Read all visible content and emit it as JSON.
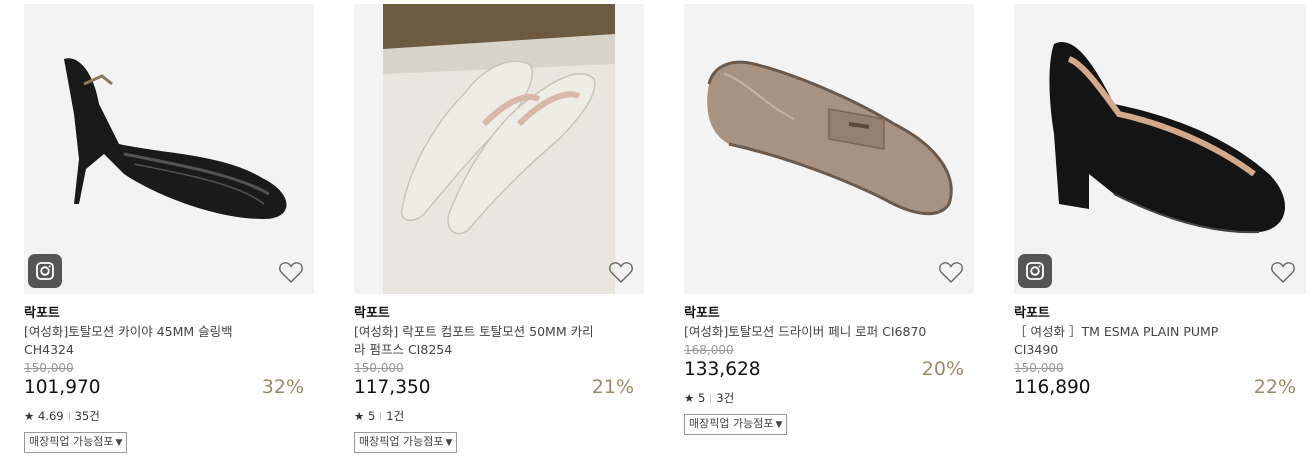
{
  "products": [
    {
      "brand": "락포트",
      "name": "[여성화]토탈모션 카이야 45MM 슬링백 CH4324",
      "original_price": "150,000",
      "price": "101,970",
      "discount": "32%",
      "rating": "4.69",
      "review_count": "35건",
      "pickup_label": "매장픽업 가능점포",
      "has_instagram": true,
      "image_icon": "black-patent-slingback-shoe-icon"
    },
    {
      "brand": "락포트",
      "name": "[여성화] 락포트 컴포트 토탈모션 50MM 카리라 펌프스 CI8254",
      "original_price": "150,000",
      "price": "117,350",
      "discount": "21%",
      "rating": "5",
      "review_count": "1건",
      "pickup_label": "매장픽업 가능점포",
      "has_instagram": false,
      "image_icon": "ivory-pump-pair-icon"
    },
    {
      "brand": "락포트",
      "name": "[여성화]토탈모션 드라이버 페니 로퍼 CI6870",
      "original_price": "168,000",
      "price": "133,628",
      "discount": "20%",
      "rating": "5",
      "review_count": "3건",
      "pickup_label": "매장픽업 가능점포",
      "has_instagram": false,
      "image_icon": "taupe-penny-loafer-icon"
    },
    {
      "brand": "락포트",
      "name": "［ 여성화 ］TM ESMA PLAIN PUMP CI3490",
      "original_price": "150,000",
      "price": "116,890",
      "discount": "22%",
      "rating": "",
      "review_count": "",
      "pickup_label": "",
      "has_instagram": true,
      "image_icon": "black-block-heel-pump-icon"
    }
  ],
  "star_glyph": "★",
  "colors": {
    "discount": "#9b8a63",
    "image_bg": "#f2f2f2"
  }
}
